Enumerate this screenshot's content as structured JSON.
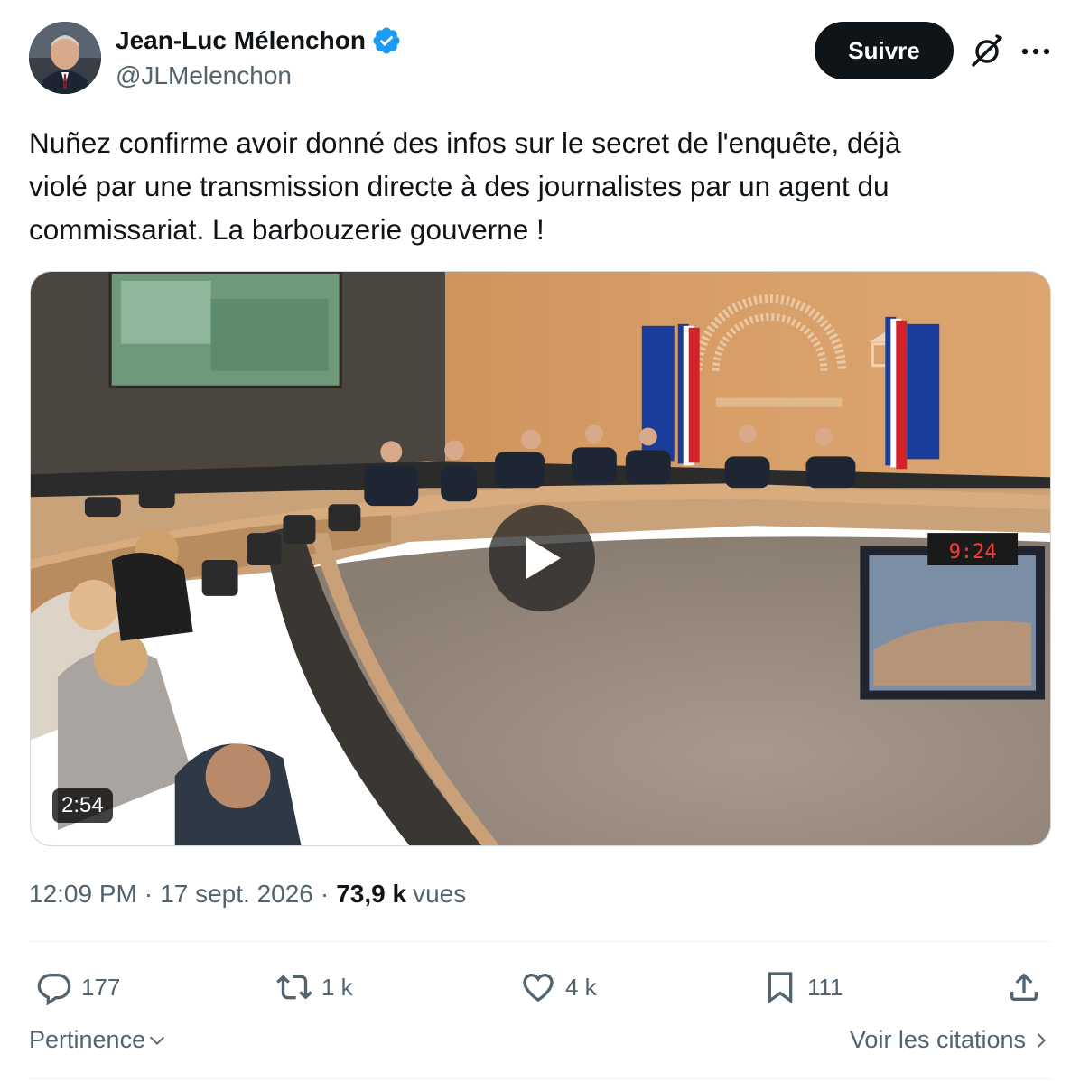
{
  "author": {
    "name": "Jean-Luc Mélenchon",
    "handle": "@JLMelenchon",
    "verified": true,
    "verified_color": "#1d9bf0"
  },
  "header": {
    "follow_label": "Suivre",
    "grok_icon": "grok-icon",
    "more_icon": "more-icon"
  },
  "tweet": {
    "text": "Nuñez confirme avoir donné des infos sur le secret de l'enquête, déjà\nviolé par une transmission directe à des journalistes par un agent du\ncommissariat. La barbouzerie gouverne !"
  },
  "media": {
    "type": "video",
    "duration": "2:54",
    "play_icon": "play-icon",
    "clock_readout": "9:24"
  },
  "meta": {
    "time": "12:09 PM",
    "date": "17 sept. 2026",
    "views_count": "73,9 k",
    "views_label": "vues",
    "separator": "·"
  },
  "actions": {
    "replies": "177",
    "reposts": "1 k",
    "likes": "4 k",
    "bookmarks": "111"
  },
  "footer": {
    "sort_label": "Pertinence",
    "quotes_label": "Voir les citations"
  },
  "colors": {
    "text_primary": "#0f1419",
    "text_secondary": "#536471",
    "button_bg": "#0f1419",
    "border": "#eff3f4"
  }
}
